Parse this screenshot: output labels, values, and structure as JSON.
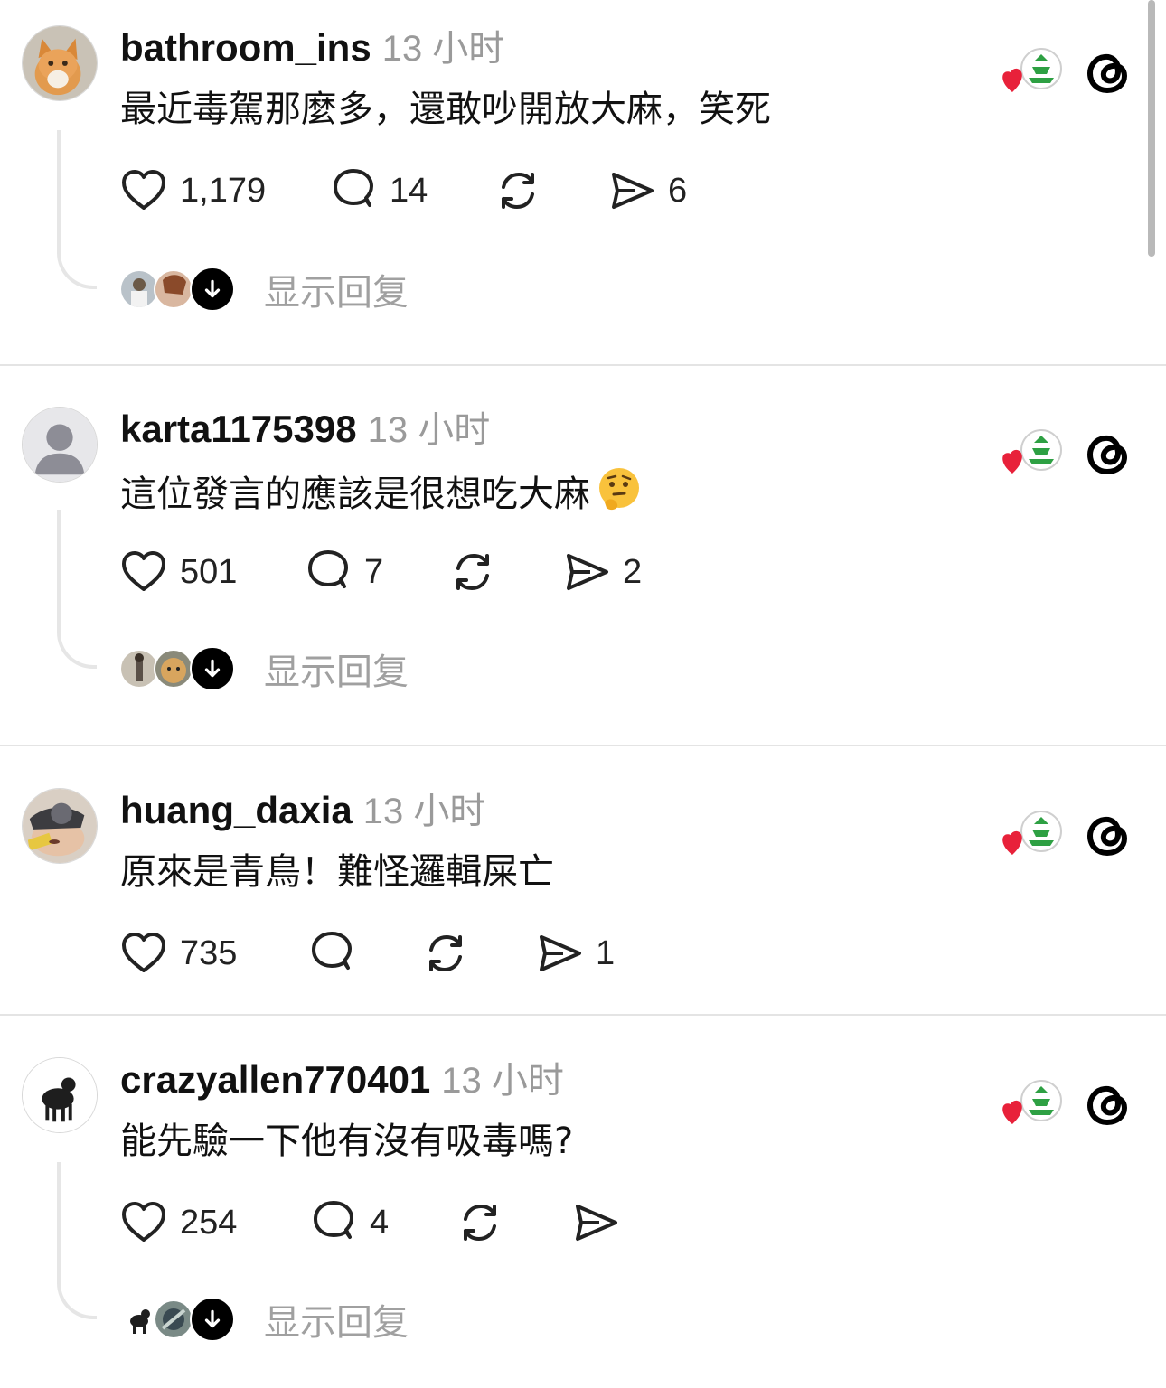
{
  "posts": [
    {
      "username": "bathroom_ins",
      "time": "13 小时",
      "text": "最近毒駕那麼多，還敢吵開放大麻，笑死",
      "likes": "1,179",
      "comments": "14",
      "shares": "6",
      "show_replies": "显示回复",
      "avatar": "cat-avatar"
    },
    {
      "username": "karta1175398",
      "time": "13 小时",
      "text": "這位發言的應該是很想吃大麻",
      "emoji": "thinking-face",
      "likes": "501",
      "comments": "7",
      "shares": "2",
      "show_replies": "显示回复",
      "avatar": "default-avatar"
    },
    {
      "username": "huang_daxia",
      "time": "13 小时",
      "text": "原來是青鳥！難怪邏輯屎亡",
      "likes": "735",
      "comments": "",
      "shares": "1",
      "avatar": "photo-avatar"
    },
    {
      "username": "crazyallen770401",
      "time": "13 小时",
      "text": "能先驗一下他有沒有吸毒嗎?",
      "likes": "254",
      "comments": "4",
      "shares": "",
      "show_replies": "显示回复",
      "avatar": "dog-avatar"
    }
  ],
  "colors": {
    "heart_badge": "#e8213a",
    "green_badge": "#2ea043",
    "muted_text": "#9a9a9a",
    "divider": "#e4e4e4"
  },
  "icons": [
    "heart-icon",
    "comment-icon",
    "repost-icon",
    "share-icon",
    "threads-logo-icon",
    "down-arrow-icon"
  ]
}
